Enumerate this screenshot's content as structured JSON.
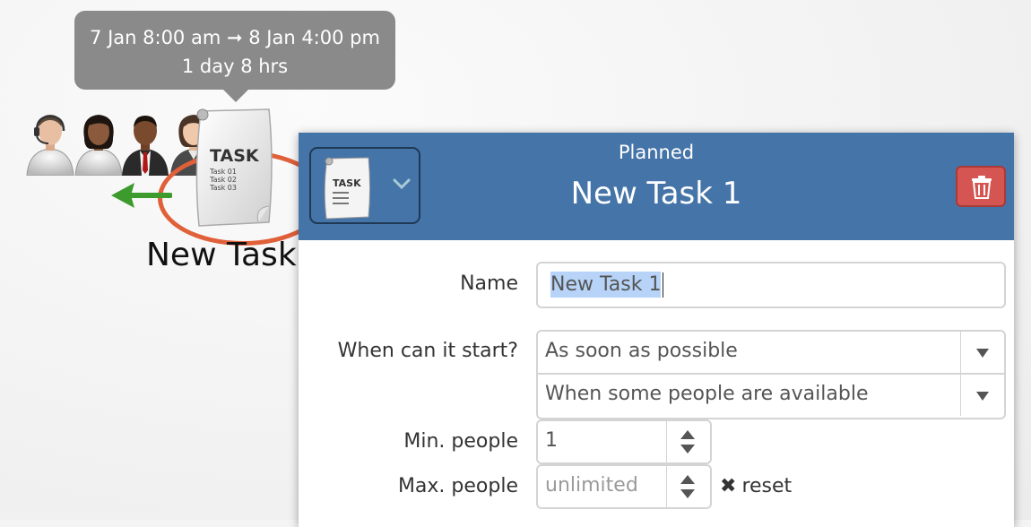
{
  "tooltip": {
    "line1": "7 Jan 8:00 am ➞ 8 Jan 4:00 pm",
    "line2": "1 day 8 hrs"
  },
  "node": {
    "label": "New Task",
    "icon_text": "TASK",
    "icon_lines": [
      "Task 01",
      "Task 02",
      "Task 03"
    ]
  },
  "dialog": {
    "status": "Planned",
    "title": "New Task 1",
    "header_color": "#4574a8",
    "delete_color": "#d45552",
    "fields": {
      "name_label": "Name",
      "name_value": "New Task 1",
      "start_label": "When can it start?",
      "start_option_1": "As soon as possible",
      "start_option_2": "When some people are available",
      "min_label": "Min. people",
      "min_value": "1",
      "max_label": "Max. people",
      "max_placeholder": "unlimited",
      "reset_label": "reset"
    }
  },
  "accent_color": "#e0603a"
}
